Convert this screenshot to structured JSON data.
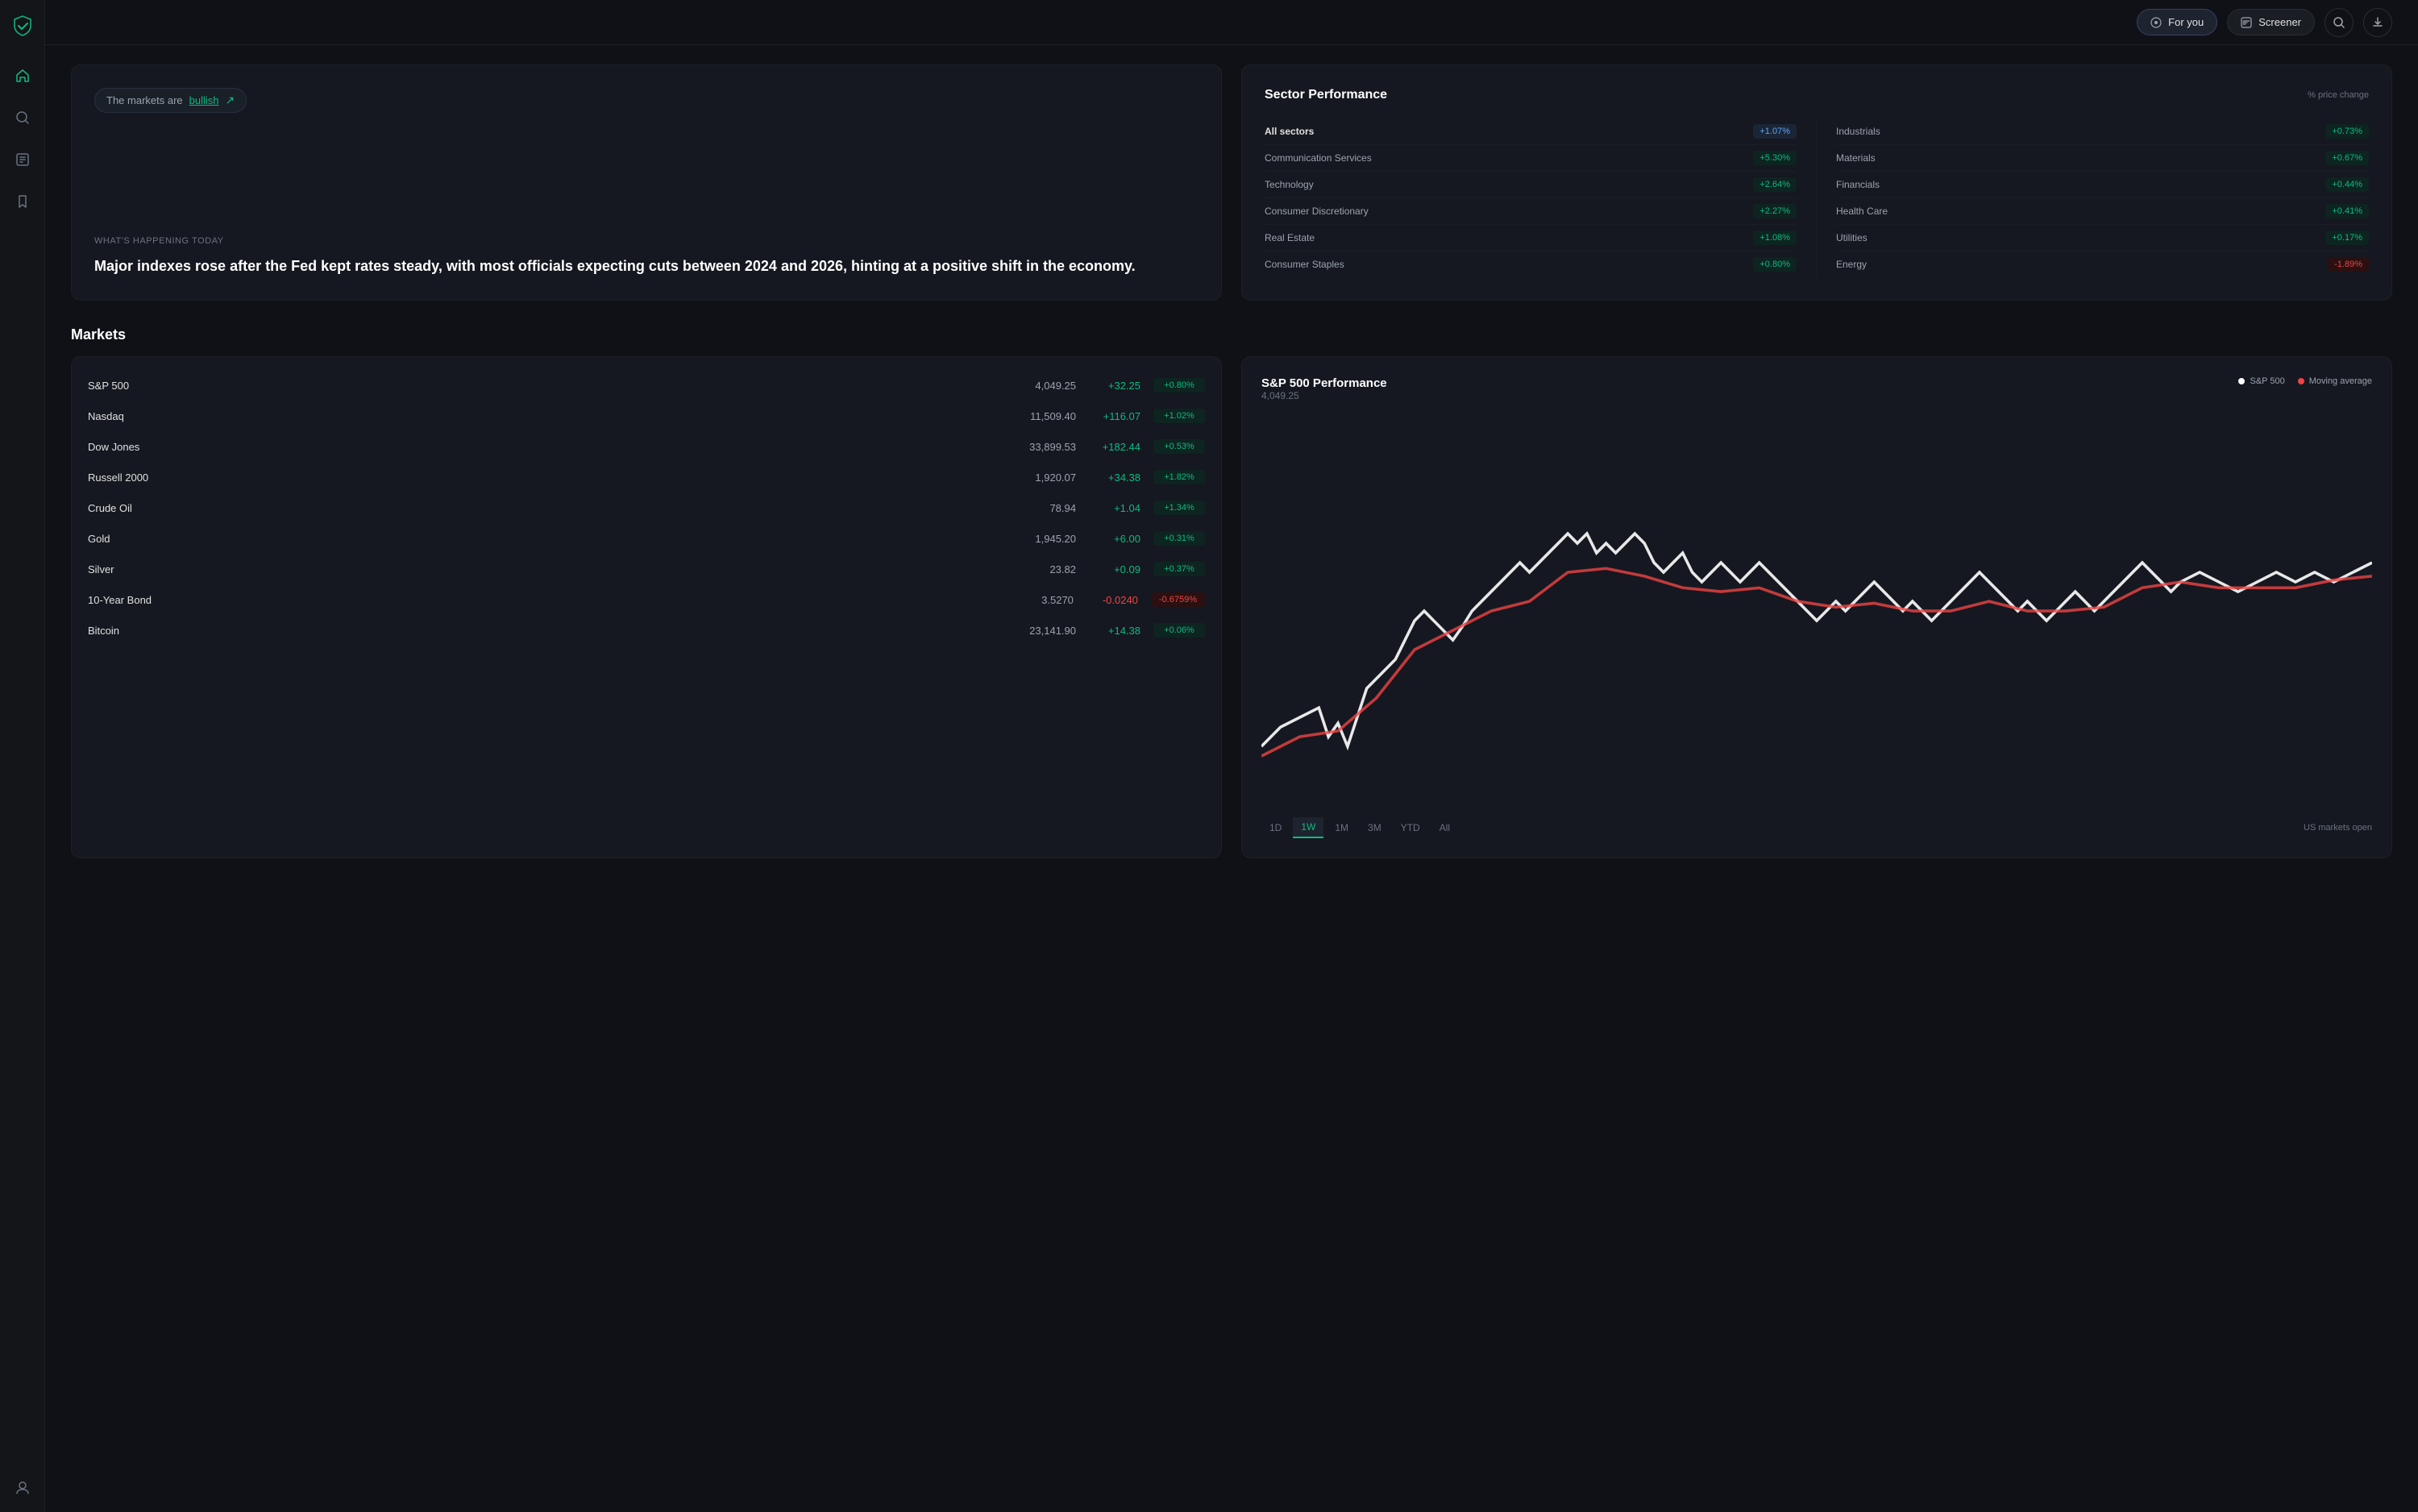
{
  "sidebar": {
    "logo": "F",
    "items": [
      {
        "name": "home",
        "icon": "⌂",
        "active": true
      },
      {
        "name": "search",
        "icon": "⌕",
        "active": false
      },
      {
        "name": "book",
        "icon": "▦",
        "active": false
      },
      {
        "name": "bookmark",
        "icon": "⊹",
        "active": false
      },
      {
        "name": "user",
        "icon": "◎",
        "active": false
      }
    ]
  },
  "topnav": {
    "for_you_label": "For you",
    "screener_label": "Screener"
  },
  "sentiment": {
    "badge_prefix": "The markets are",
    "badge_word": "bullish",
    "what_happening": "What's happening today",
    "headline": "Major indexes rose after the Fed kept rates steady, with most officials expecting cuts between 2024 and 2026, hinting at a positive shift in the economy."
  },
  "sector_performance": {
    "title": "Sector Performance",
    "subtitle": "% price change",
    "left_sectors": [
      {
        "name": "All sectors",
        "change": "+1.07%",
        "type": "all",
        "bold": true
      },
      {
        "name": "Communication Services",
        "change": "+5.30%",
        "type": "green"
      },
      {
        "name": "Technology",
        "change": "+2.64%",
        "type": "green"
      },
      {
        "name": "Consumer Discretionary",
        "change": "+2.27%",
        "type": "green"
      },
      {
        "name": "Real Estate",
        "change": "+1.08%",
        "type": "green"
      },
      {
        "name": "Consumer Staples",
        "change": "+0.80%",
        "type": "green"
      }
    ],
    "right_sectors": [
      {
        "name": "Industrials",
        "change": "+0.73%",
        "type": "green"
      },
      {
        "name": "Materials",
        "change": "+0.67%",
        "type": "green"
      },
      {
        "name": "Financials",
        "change": "+0.44%",
        "type": "green"
      },
      {
        "name": "Health Care",
        "change": "+0.41%",
        "type": "green"
      },
      {
        "name": "Utilities",
        "change": "+0.17%",
        "type": "green"
      },
      {
        "name": "Energy",
        "change": "-1.89%",
        "type": "red"
      }
    ]
  },
  "markets_title": "Markets",
  "markets_table": [
    {
      "name": "S&P 500",
      "price": "4,049.25",
      "change": "+32.25",
      "pct": "+0.80%",
      "type": "green"
    },
    {
      "name": "Nasdaq",
      "price": "11,509.40",
      "change": "+116.07",
      "pct": "+1.02%",
      "type": "green"
    },
    {
      "name": "Dow Jones",
      "price": "33,899.53",
      "change": "+182.44",
      "pct": "+0.53%",
      "type": "green"
    },
    {
      "name": "Russell 2000",
      "price": "1,920.07",
      "change": "+34.38",
      "pct": "+1.82%",
      "type": "green"
    },
    {
      "name": "Crude Oil",
      "price": "78.94",
      "change": "+1.04",
      "pct": "+1.34%",
      "type": "green"
    },
    {
      "name": "Gold",
      "price": "1,945.20",
      "change": "+6.00",
      "pct": "+0.31%",
      "type": "green"
    },
    {
      "name": "Silver",
      "price": "23.82",
      "change": "+0.09",
      "pct": "+0.37%",
      "type": "green"
    },
    {
      "name": "10-Year Bond",
      "price": "3.5270",
      "change": "-0.0240",
      "pct": "-0.6759%",
      "type": "red"
    },
    {
      "name": "Bitcoin",
      "price": "23,141.90",
      "change": "+14.38",
      "pct": "+0.06%",
      "type": "green"
    }
  ],
  "chart": {
    "title": "S&P 500 Performance",
    "price": "4,049.25",
    "legend": [
      {
        "label": "S&P 500",
        "color": "#ffffff"
      },
      {
        "label": "Moving average",
        "color": "#ef4444"
      }
    ],
    "time_tabs": [
      "1D",
      "1W",
      "1M",
      "3M",
      "YTD",
      "All"
    ],
    "active_tab": "1W",
    "market_status": "US markets open"
  }
}
